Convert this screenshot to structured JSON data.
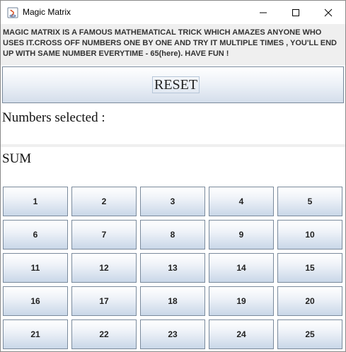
{
  "window": {
    "title": "Magic Matrix"
  },
  "description": "MAGIC MATRIX IS A FAMOUS MATHEMATICAL TRICK WHICH AMAZES ANYONE WHO USES IT.CROSS OFF NUMBERS ONE BY ONE AND TRY IT MULTIPLE TIMES , YOU'LL END UP WITH SAME NUMBER EVERYTIME - 65(here). HAVE FUN !",
  "reset_label": "RESET",
  "selected_label": "Numbers selected :",
  "sum_label": "SUM",
  "numbers": [
    "1",
    "2",
    "3",
    "4",
    "5",
    "6",
    "7",
    "8",
    "9",
    "10",
    "11",
    "12",
    "13",
    "14",
    "15",
    "16",
    "17",
    "18",
    "19",
    "20",
    "21",
    "22",
    "23",
    "24",
    "25"
  ]
}
